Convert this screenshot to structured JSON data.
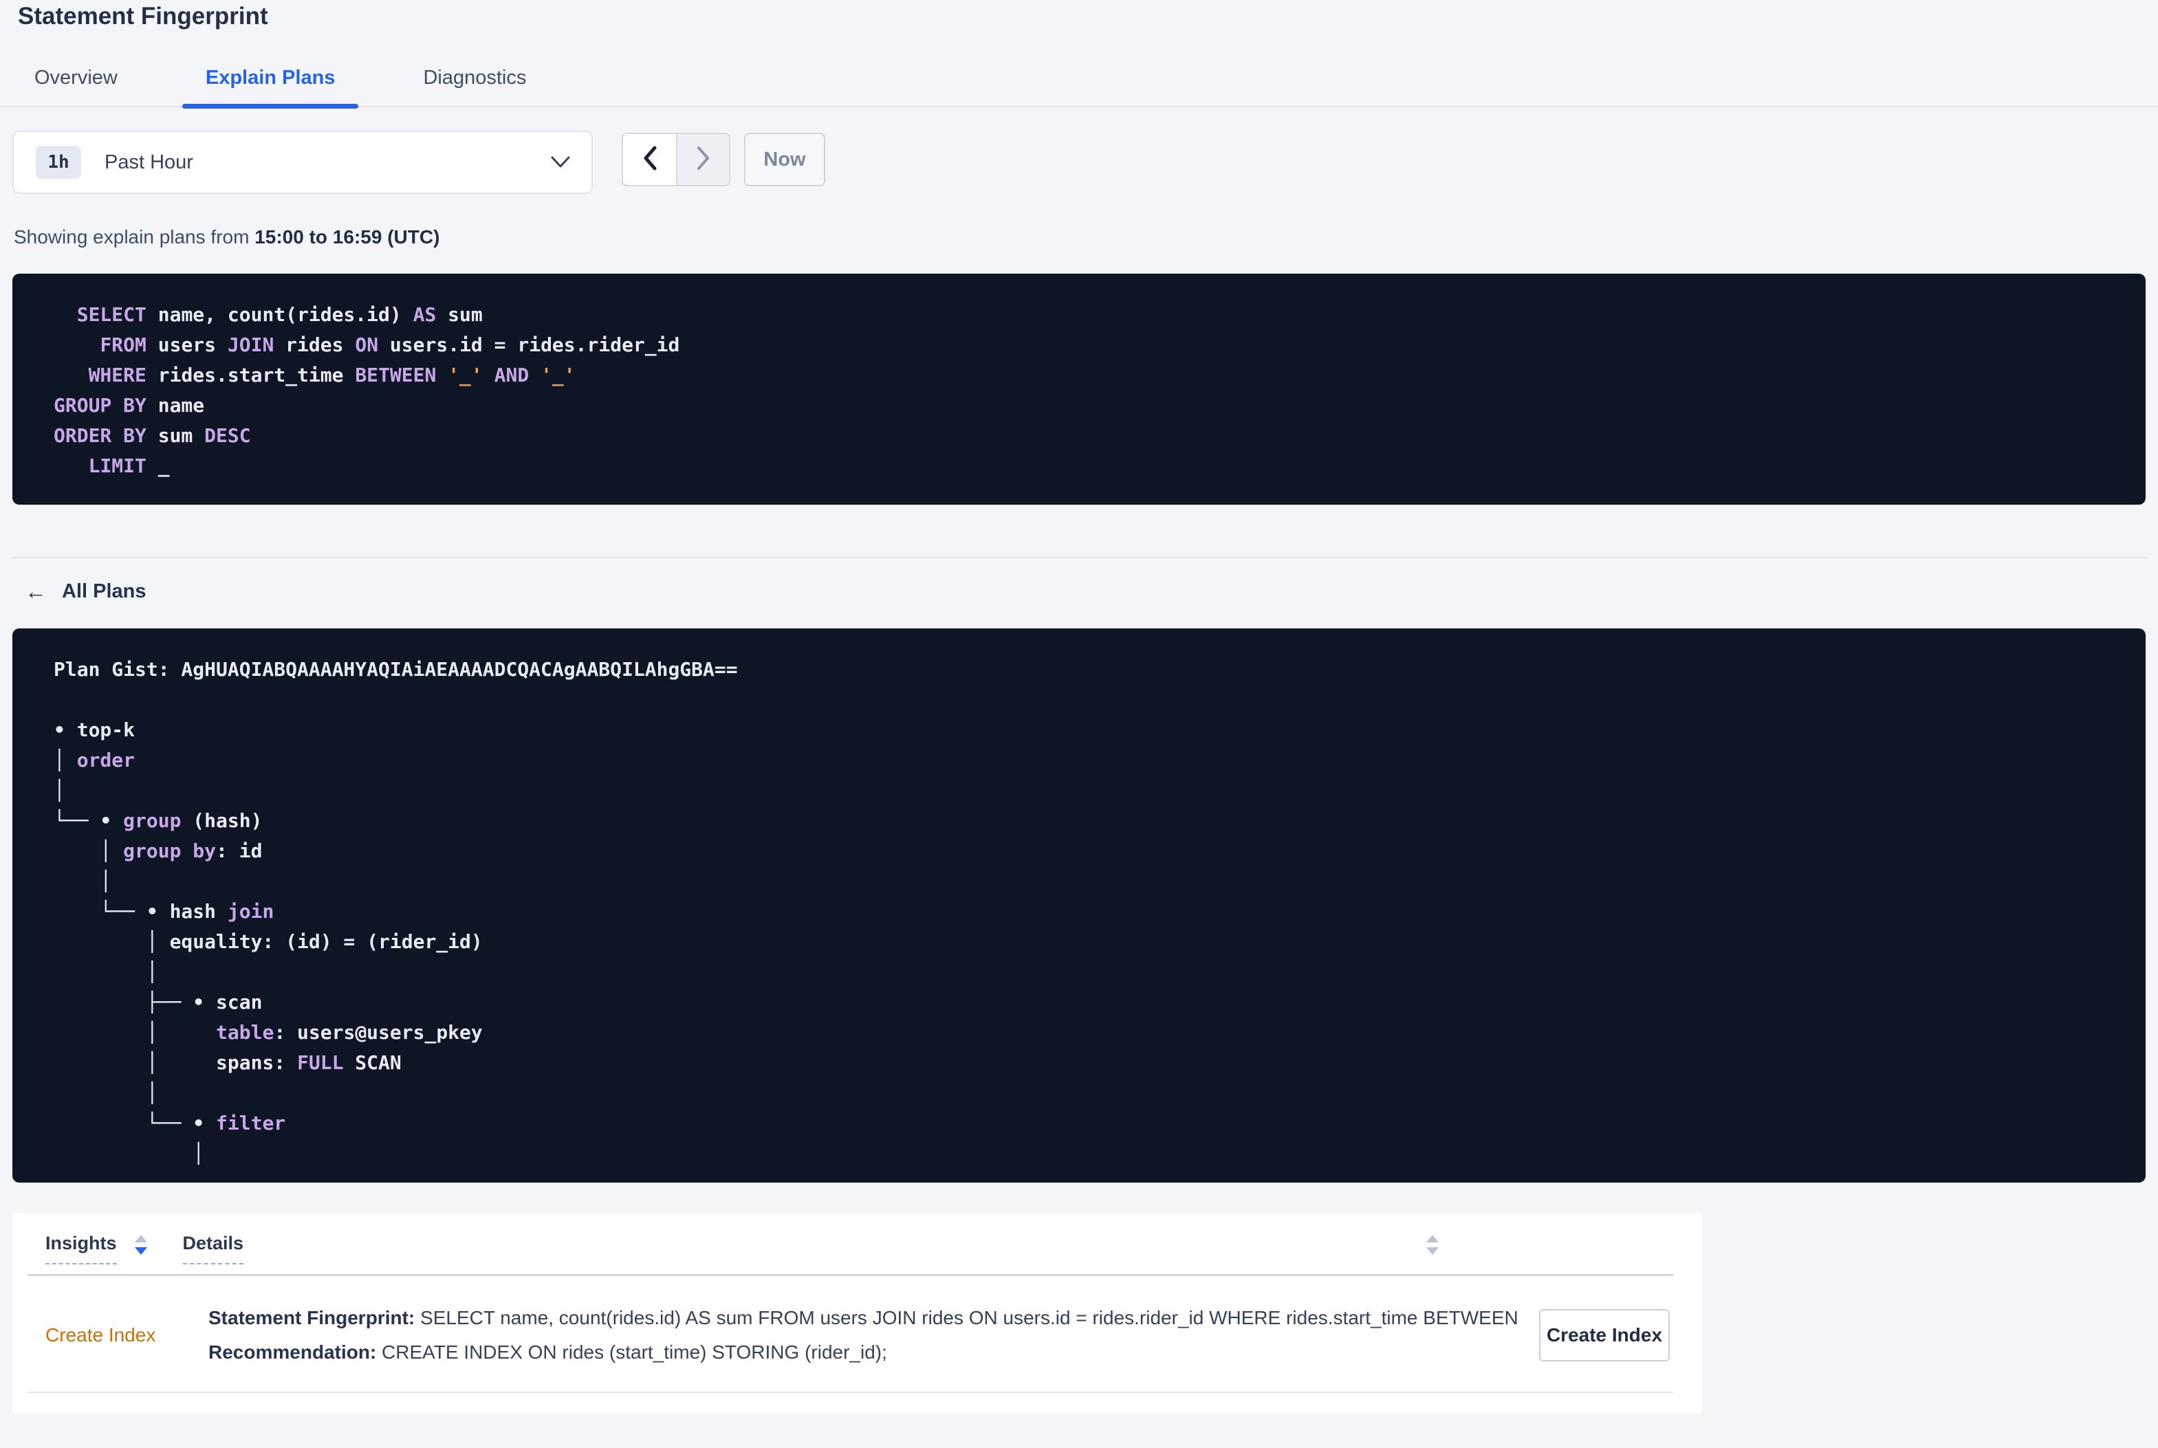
{
  "colors": {
    "accent_blue": "#2264f0",
    "insight_orange": "#c9710c",
    "code_bg": "#0e1626",
    "code_text": "#e9ecf4",
    "code_keyword": "#c7a7e8",
    "code_string": "#ef9b3d"
  },
  "page": {
    "title": "Statement Fingerprint"
  },
  "tabs": [
    {
      "label": "Overview"
    },
    {
      "label": "Explain Plans"
    },
    {
      "label": "Diagnostics"
    }
  ],
  "time_picker": {
    "badge": "1h",
    "selected": "Past Hour",
    "now_label": "Now"
  },
  "status": {
    "prefix": "Showing explain plans from ",
    "range": "15:00 to 16:59 (UTC)"
  },
  "sql": {
    "lines": [
      [
        [
          "t",
          "  "
        ],
        [
          "k",
          "SELECT"
        ],
        [
          "t",
          " name, count(rides.id) "
        ],
        [
          "k",
          "AS"
        ],
        [
          "t",
          " sum"
        ]
      ],
      [
        [
          "t",
          "    "
        ],
        [
          "k",
          "FROM"
        ],
        [
          "t",
          " users "
        ],
        [
          "k",
          "JOIN"
        ],
        [
          "t",
          " rides "
        ],
        [
          "k",
          "ON"
        ],
        [
          "t",
          " users.id = rides.rider_id"
        ]
      ],
      [
        [
          "t",
          "   "
        ],
        [
          "k",
          "WHERE"
        ],
        [
          "t",
          " rides.start_time "
        ],
        [
          "k",
          "BETWEEN"
        ],
        [
          "t",
          " "
        ],
        [
          "s",
          "'_'"
        ],
        [
          "t",
          " "
        ],
        [
          "k",
          "AND"
        ],
        [
          "t",
          " "
        ],
        [
          "s",
          "'_'"
        ]
      ],
      [
        [
          "k",
          "GROUP BY"
        ],
        [
          "t",
          " name"
        ]
      ],
      [
        [
          "k",
          "ORDER BY"
        ],
        [
          "t",
          " sum "
        ],
        [
          "k",
          "DESC"
        ]
      ],
      [
        [
          "t",
          "   "
        ],
        [
          "k",
          "LIMIT"
        ],
        [
          "t",
          " _"
        ]
      ]
    ]
  },
  "all_plans": {
    "icon": "←",
    "label": "All Plans"
  },
  "plan": {
    "gist": "Plan Gist: AgHUAQIABQAAAAHYAQIAiAEAAAADCQACAgAABQILAhgGBA==",
    "tree": [
      [
        [
          "t",
          "• top-k"
        ]
      ],
      [
        [
          "t",
          "│ "
        ],
        [
          "k",
          "order"
        ]
      ],
      [
        [
          "t",
          "│"
        ]
      ],
      [
        [
          "t",
          "└── • "
        ],
        [
          "k",
          "group"
        ],
        [
          "t",
          " (hash)"
        ]
      ],
      [
        [
          "t",
          "    │ "
        ],
        [
          "k",
          "group by"
        ],
        [
          "t",
          ": id"
        ]
      ],
      [
        [
          "t",
          "    │"
        ]
      ],
      [
        [
          "t",
          "    └── • hash "
        ],
        [
          "k",
          "join"
        ]
      ],
      [
        [
          "t",
          "        │ equality: (id) = (rider_id)"
        ]
      ],
      [
        [
          "t",
          "        │"
        ]
      ],
      [
        [
          "t",
          "        ├── • scan"
        ]
      ],
      [
        [
          "t",
          "        │     "
        ],
        [
          "k",
          "table"
        ],
        [
          "t",
          ": users@users_pkey"
        ]
      ],
      [
        [
          "t",
          "        │     spans: "
        ],
        [
          "k",
          "FULL"
        ],
        [
          "t",
          " SCAN"
        ]
      ],
      [
        [
          "t",
          "        │"
        ]
      ],
      [
        [
          "t",
          "        └── • "
        ],
        [
          "k",
          "filter"
        ]
      ],
      [
        [
          "t",
          "            │"
        ]
      ]
    ]
  },
  "insights_table": {
    "columns": [
      "Insights",
      "Details"
    ],
    "row": {
      "insight": "Create Index",
      "fingerprint_label": "Statement Fingerprint:",
      "fingerprint_text": " SELECT name, count(rides.id) AS sum FROM users JOIN rides ON users.id = rides.rider_id WHERE rides.start_time BETWEEN '_…",
      "recommendation_label": "Recommendation:",
      "recommendation_text": " CREATE INDEX ON rides (start_time) STORING (rider_id);",
      "action_label": "Create Index"
    }
  }
}
